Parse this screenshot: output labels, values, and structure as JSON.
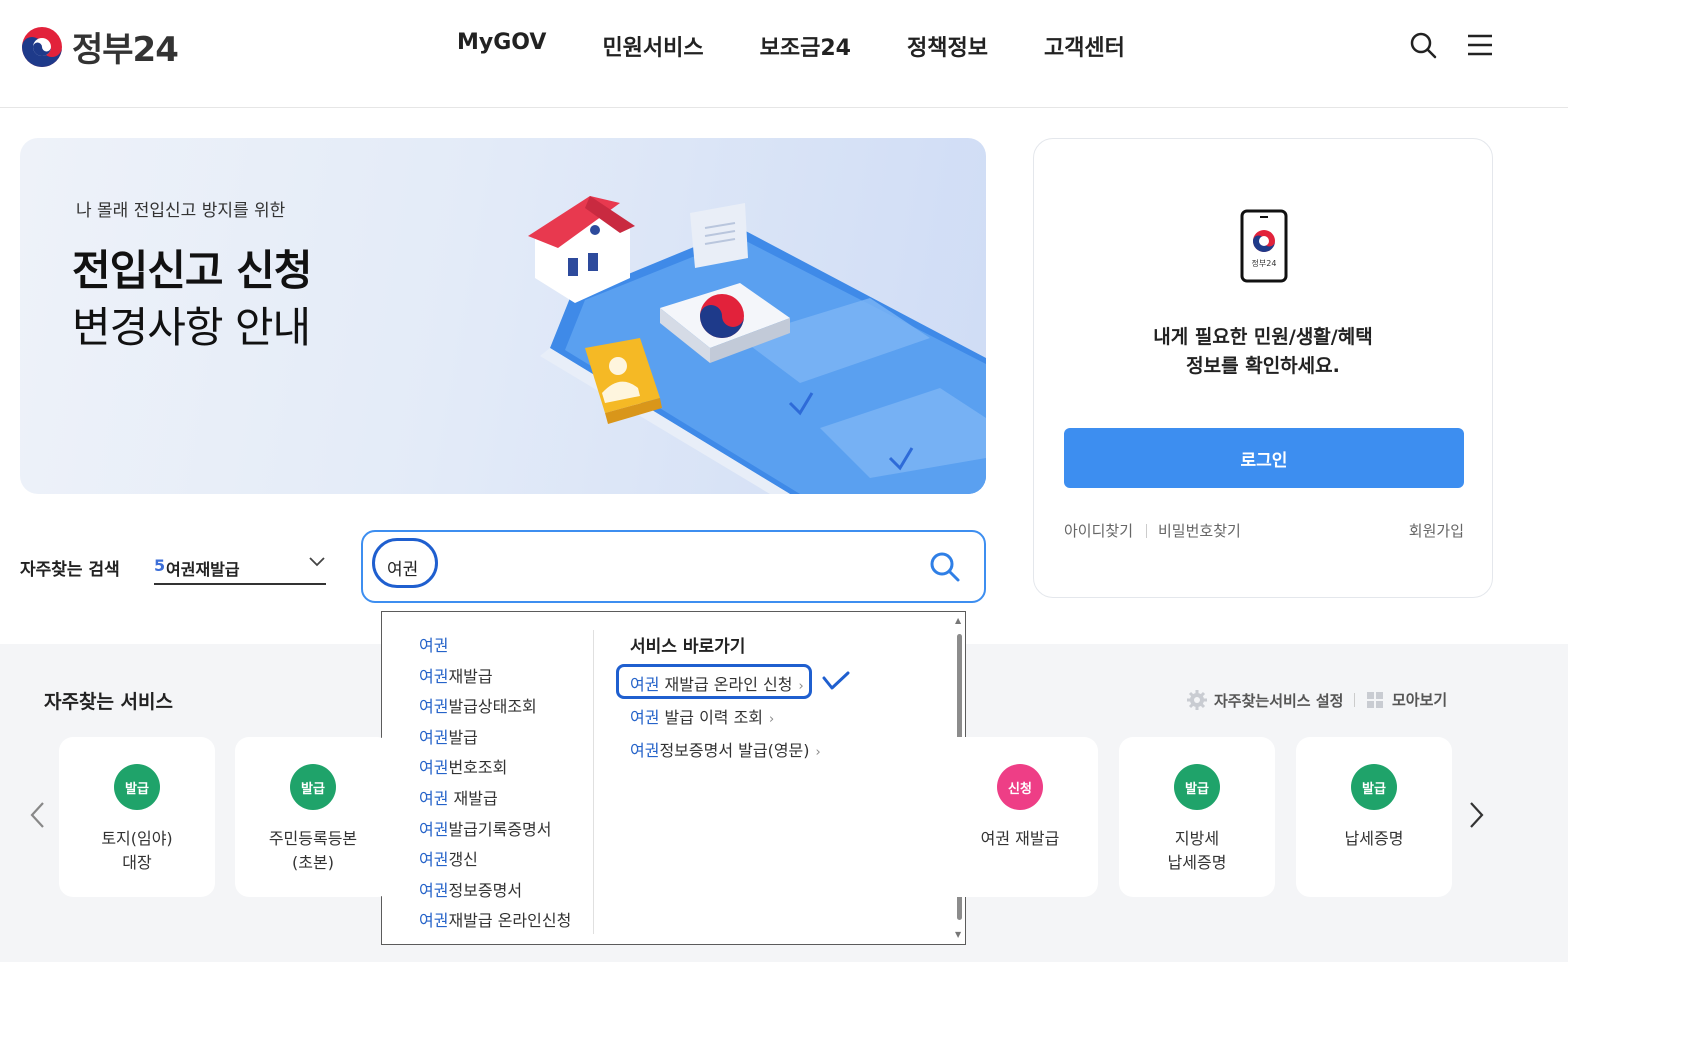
{
  "header": {
    "logo_text": "정부24",
    "nav": [
      "MyGOV",
      "민원서비스",
      "보조금24",
      "정책정보",
      "고객센터"
    ],
    "search_icon": "search-icon",
    "menu_icon": "hamburger-menu-icon"
  },
  "banner": {
    "subtitle": "나 몰래 전입신고 방지를 위한",
    "title_line1": "전입신고 신청",
    "title_line2": "변경사항 안내"
  },
  "login": {
    "phone_label": "정부24",
    "message_line1": "내게 필요한 민원/생활/혜택",
    "message_line2": "정보를 확인하세요.",
    "login_button": "로그인",
    "find_id": "아이디찾기",
    "find_password": "비밀번호찾기",
    "signup": "회원가입"
  },
  "search": {
    "frequent_label": "자주찾는 검색",
    "frequent_rank": "5",
    "frequent_selected": "여권재발급",
    "query": "여권"
  },
  "dropdown": {
    "suggestions": [
      {
        "hl": "여권",
        "rest": ""
      },
      {
        "hl": "여권",
        "rest": "재발급"
      },
      {
        "hl": "여권",
        "rest": "발급상태조회"
      },
      {
        "hl": "여권",
        "rest": "발급"
      },
      {
        "hl": "여권",
        "rest": "번호조회"
      },
      {
        "hl": "여권",
        "rest": " 재발급"
      },
      {
        "hl": "여권",
        "rest": "발급기록증명서"
      },
      {
        "hl": "여권",
        "rest": "갱신"
      },
      {
        "hl": "여권",
        "rest": "정보증명서"
      },
      {
        "hl": "여권",
        "rest": "재발급 온라인신청"
      }
    ],
    "shortcut_title": "서비스 바로가기",
    "shortcuts": [
      {
        "hl": "여권",
        "rest": " 재발급 온라인 신청"
      },
      {
        "hl": "여권",
        "rest": " 발급 이력 조회"
      },
      {
        "hl": "여권",
        "rest": "정보증명서 발급(영문)"
      }
    ]
  },
  "services": {
    "heading": "자주찾는 서비스",
    "settings": "자주찾는서비스 설정",
    "view_all": "모아보기",
    "cards": [
      {
        "badge": "발급",
        "label": "토지(임야)\n대장",
        "color": "#1fa36a"
      },
      {
        "badge": "발급",
        "label": "주민등록등본\n(초본)",
        "color": "#1fa36a"
      },
      {
        "badge": "신청",
        "label": "여권 재발급",
        "color": "#ee3e86"
      },
      {
        "badge": "발급",
        "label": "지방세\n납세증명",
        "color": "#1fa36a"
      },
      {
        "badge": "발급",
        "label": "납세증명",
        "color": "#1fa36a"
      }
    ]
  },
  "colors": {
    "primary": "#3d8ef0",
    "highlight_text": "#2563c9",
    "issue_badge": "#1fa36a",
    "apply_badge": "#ee3e86"
  }
}
